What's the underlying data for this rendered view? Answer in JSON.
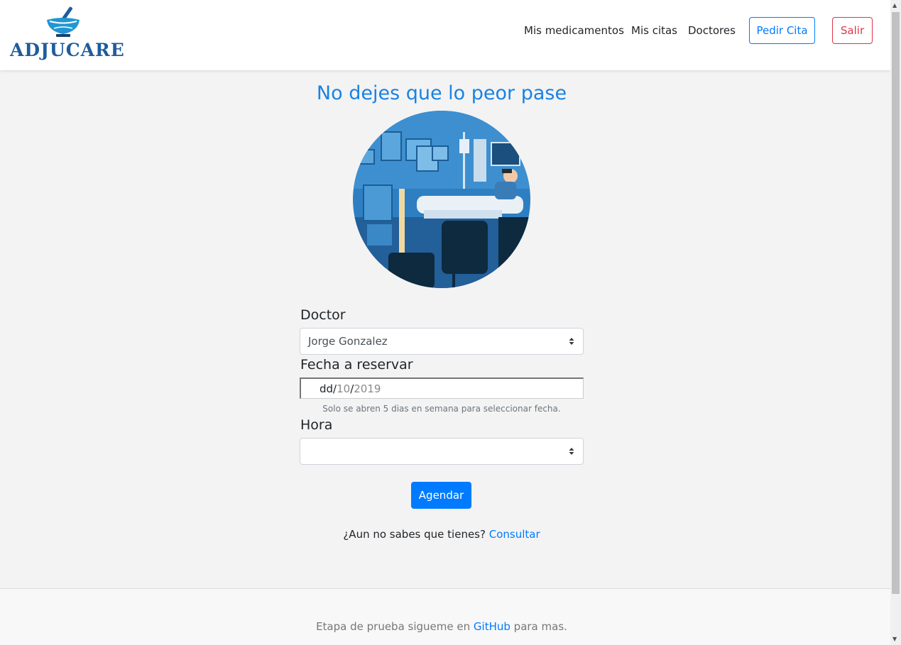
{
  "brand": {
    "name": "ADJUCARE"
  },
  "nav": {
    "links": [
      {
        "label": "Mis medicamentos"
      },
      {
        "label": "Mis citas"
      },
      {
        "label": "Doctores"
      }
    ],
    "pedir_cita": "Pedir Cita",
    "salir": "Salir"
  },
  "main": {
    "title": "No dejes que lo peor pase",
    "form": {
      "doctor_label": "Doctor",
      "doctor_value": "Jorge Gonzalez",
      "fecha_label": "Fecha a reservar",
      "fecha_day": "dd",
      "fecha_month": "10",
      "fecha_year": "2019",
      "fecha_sep": "/",
      "fecha_help": "Solo se abren 5 dias en semana para seleccionar fecha.",
      "hora_label": "Hora",
      "hora_value": "",
      "submit": "Agendar"
    },
    "consult_prompt": "¿Aun no sabes que tienes?",
    "consult_link": "Consultar"
  },
  "footer": {
    "text_before": "Etapa de prueba sigueme en",
    "link": "GitHub",
    "text_after": "para mas."
  },
  "colors": {
    "primary": "#007bff",
    "danger": "#dc3545",
    "title": "#1a82e2",
    "background": "#f3f3f3"
  }
}
